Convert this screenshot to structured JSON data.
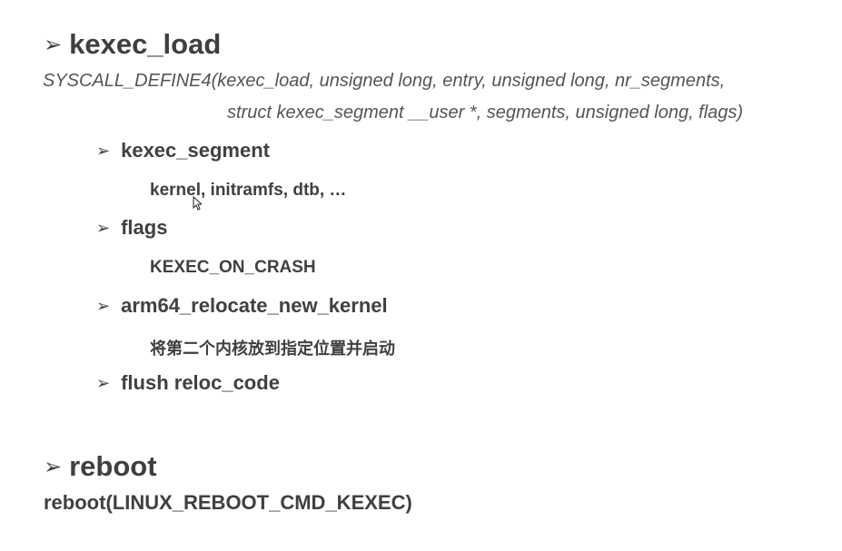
{
  "bullet_glyph": "➢",
  "sections": {
    "kexec_load": {
      "title": "kexec_load",
      "signature_line1": "SYSCALL_DEFINE4(kexec_load, unsigned long, entry, unsigned long, nr_segments,",
      "signature_line2": "struct kexec_segment __user *, segments, unsigned long, flags)",
      "items": [
        {
          "label": "kexec_segment",
          "detail": "kernel, initramfs, dtb, …"
        },
        {
          "label": "flags",
          "detail": "KEXEC_ON_CRASH"
        },
        {
          "label": "arm64_relocate_new_kernel",
          "detail": "将第二个内核放到指定位置并启动"
        },
        {
          "label": "flush reloc_code",
          "detail": ""
        }
      ]
    },
    "reboot": {
      "title": "reboot",
      "call": "reboot(LINUX_REBOOT_CMD_KEXEC)"
    }
  },
  "colors": {
    "heading": "#3f3f3f",
    "text": "#404040",
    "signature": "#555555",
    "background": "#ffffff"
  }
}
